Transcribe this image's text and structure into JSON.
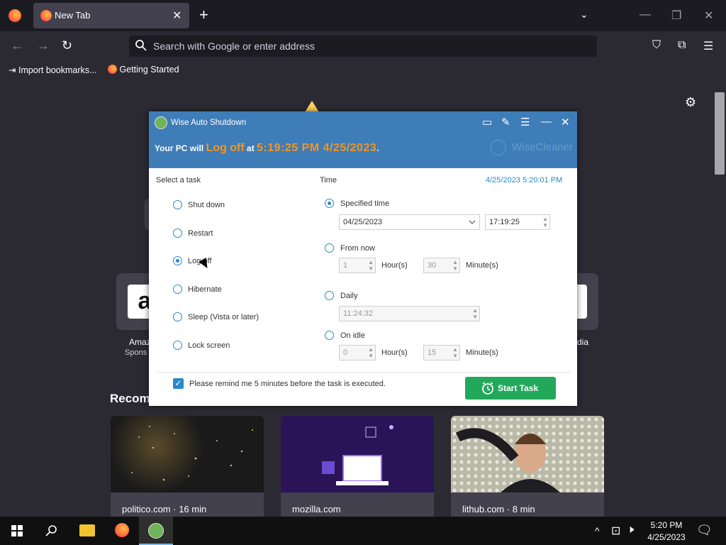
{
  "browser": {
    "tab": {
      "title": "New Tab",
      "close": "✕"
    },
    "newtab": "+",
    "tablist": "⌄",
    "window_controls": {
      "minimize": "—",
      "restore": "❐",
      "close": "✕"
    },
    "nav": {
      "back": "←",
      "forward": "→",
      "reload": "↻"
    },
    "url_placeholder": "Search with Google or enter address",
    "toolbar_icons": {
      "pocket": "⛉",
      "extensions": "⧉",
      "menu": "☰"
    },
    "bookmarks": [
      {
        "label": "Import bookmarks...",
        "icon": "import-icon"
      },
      {
        "label": "Getting Started",
        "icon": "firefox-icon"
      }
    ]
  },
  "newtab": {
    "settings_icon": "⚙",
    "shortcuts": [
      {
        "label": "Amaz",
        "sub": "Spons",
        "glyph": "a"
      },
      {
        "label": "dia",
        "sub": "",
        "glyph": ""
      }
    ],
    "recommended_title": "Recom",
    "cards": [
      {
        "label": "politico.com · 16 min"
      },
      {
        "label": "mozilla.com"
      },
      {
        "label": "lithub.com · 8 min"
      }
    ]
  },
  "dialog": {
    "title": "Wise Auto Shutdown",
    "header_icons": {
      "feedback": "▭",
      "edit": "✎",
      "menu": "☰",
      "minimize": "—",
      "close": "✕"
    },
    "status": {
      "prefix": "Your PC will",
      "action": "Log off",
      "at": "at",
      "time": "5:19:25 PM 4/25/2023",
      "suffix": "."
    },
    "brand": "WiseCleaner",
    "select_task_label": "Select a task",
    "tasks": [
      {
        "label": "Shut down",
        "selected": false
      },
      {
        "label": "Restart",
        "selected": false
      },
      {
        "label": "Log off",
        "selected": true
      },
      {
        "label": "Hibernate",
        "selected": false
      },
      {
        "label": "Sleep (Vista or later)",
        "selected": false
      },
      {
        "label": "Lock screen",
        "selected": false
      }
    ],
    "time_label": "Time",
    "current_datetime": "4/25/2023 5:20:01 PM",
    "specified": {
      "label": "Specified time",
      "selected": true,
      "date": "04/25/2023",
      "time": "17:19:25"
    },
    "from_now": {
      "label": "From now",
      "selected": false,
      "hours": "1",
      "hours_label": "Hour(s)",
      "minutes": "30",
      "minutes_label": "Minute(s)"
    },
    "daily": {
      "label": "Daily",
      "selected": false,
      "time": "11:24:32"
    },
    "on_idle": {
      "label": "On idle",
      "selected": false,
      "hours": "0",
      "hours_label": "Hour(s)",
      "minutes": "15",
      "minutes_label": "Minute(s)"
    },
    "remind_text": "Please remind me 5 minutes before the task is executed.",
    "remind_checked": true,
    "start_button": "Start Task"
  },
  "taskbar": {
    "time": "5:20 PM",
    "date": "4/25/2023",
    "tray": {
      "chevron": "^",
      "network": "⊡",
      "volume": "🕨",
      "notifications": "🗨"
    }
  },
  "colors": {
    "accent": "#3e7db8",
    "status_orange": "#f7941d",
    "start_green": "#22a85a",
    "radio_blue": "#2a8ac9"
  }
}
